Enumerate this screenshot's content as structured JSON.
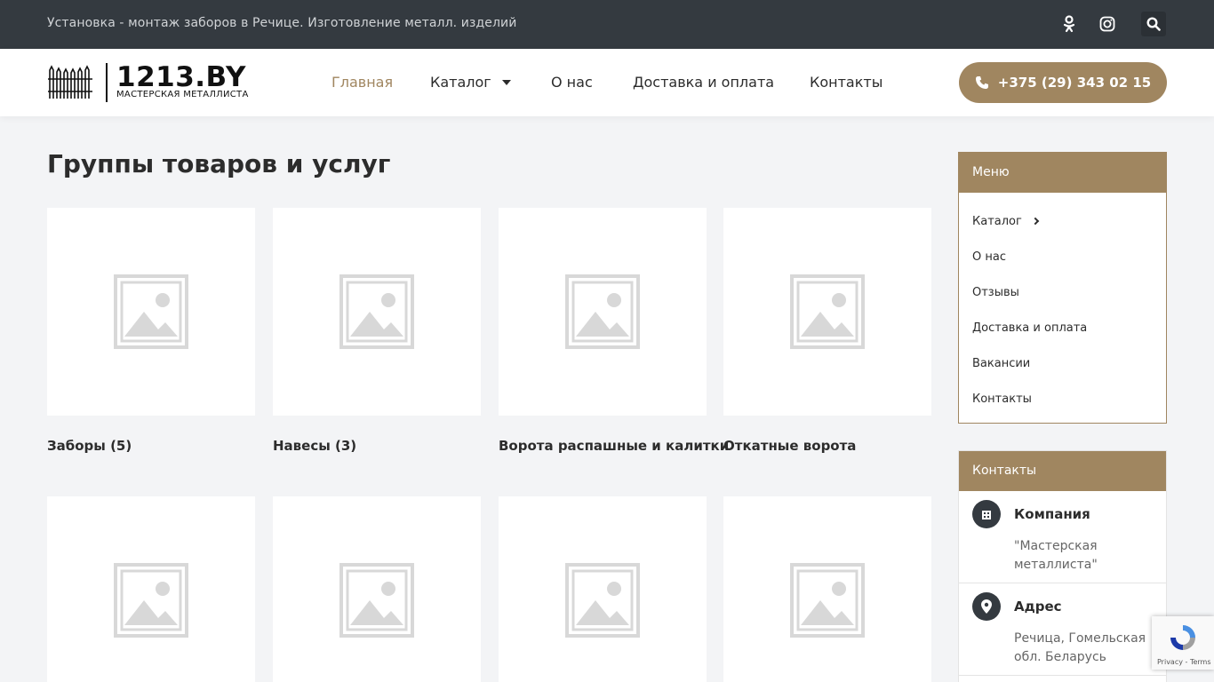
{
  "topbar": {
    "tagline": "Установка - монтаж заборов в Речице. Изготовление металл. изделий",
    "icons": [
      "odnoklassniki-icon",
      "instagram-icon",
      "search-icon"
    ]
  },
  "header": {
    "logo_main": "1213.BY",
    "logo_sub": "МАСТЕРСКАЯ МЕТАЛЛИСТА",
    "nav": [
      {
        "label": "Главная"
      },
      {
        "label": "Каталог"
      },
      {
        "label": "О нас"
      },
      {
        "label": "Доставка и оплата"
      },
      {
        "label": "Контакты"
      }
    ],
    "phone": "+375 (29) 343 02 15"
  },
  "main": {
    "title": "Группы товаров и услуг",
    "cards": [
      {
        "title": "Заборы (5)"
      },
      {
        "title": "Навесы (3)"
      },
      {
        "title": "Ворота распашные и калитки"
      },
      {
        "title": "Откатные ворота"
      },
      {
        "title": ""
      },
      {
        "title": ""
      },
      {
        "title": ""
      },
      {
        "title": ""
      }
    ]
  },
  "sidebar": {
    "menu_title": "Меню",
    "menu_items": [
      {
        "label": "Каталог"
      },
      {
        "label": "О нас"
      },
      {
        "label": "Отзывы"
      },
      {
        "label": "Доставка и оплата"
      },
      {
        "label": "Вакансии"
      },
      {
        "label": "Контакты"
      }
    ],
    "contacts_title": "Контакты",
    "contacts": [
      {
        "title": "Компания",
        "value": "\"Мастерская металлиста\""
      },
      {
        "title": "Адрес",
        "value": "Речица, Гомельская обл. Беларусь"
      }
    ]
  },
  "recaptcha": {
    "text": "Privacy - Terms"
  },
  "colors": {
    "accent": "#a08660",
    "dark": "#343a40"
  }
}
